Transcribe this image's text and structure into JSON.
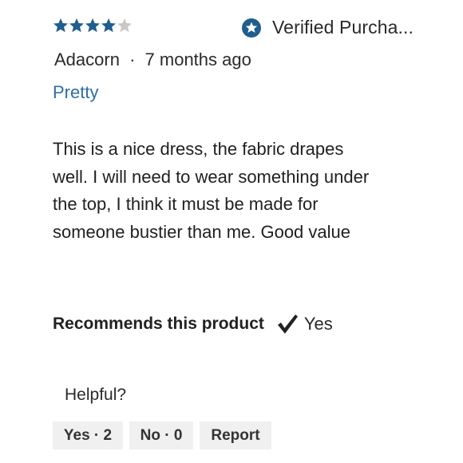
{
  "review": {
    "rating": 4,
    "rating_max": 5,
    "verified_label": "Verified Purcha...",
    "author": "Adacorn",
    "separator": "·",
    "time_ago": "7 months ago",
    "title": "Pretty",
    "body": "This is a nice dress, the fabric drapes well. I will need to wear something under the top, I think it must be made for someone bustier than me. Good value",
    "recommends_label": "Recommends this product",
    "recommends_value": "Yes",
    "helpful_label": "Helpful?",
    "buttons": {
      "yes_label": "Yes · 2",
      "no_label": "No · 0",
      "report_label": "Report"
    }
  },
  "colors": {
    "star_filled": "#1f5e8e",
    "star_empty": "#c8c8c8",
    "verified_icon": "#1f5e8e",
    "title": "#2f6fa5",
    "button_bg": "#f0f0f0"
  },
  "icons": {
    "star": "star-icon",
    "verified": "verified-badge-icon",
    "check": "checkmark-icon"
  }
}
